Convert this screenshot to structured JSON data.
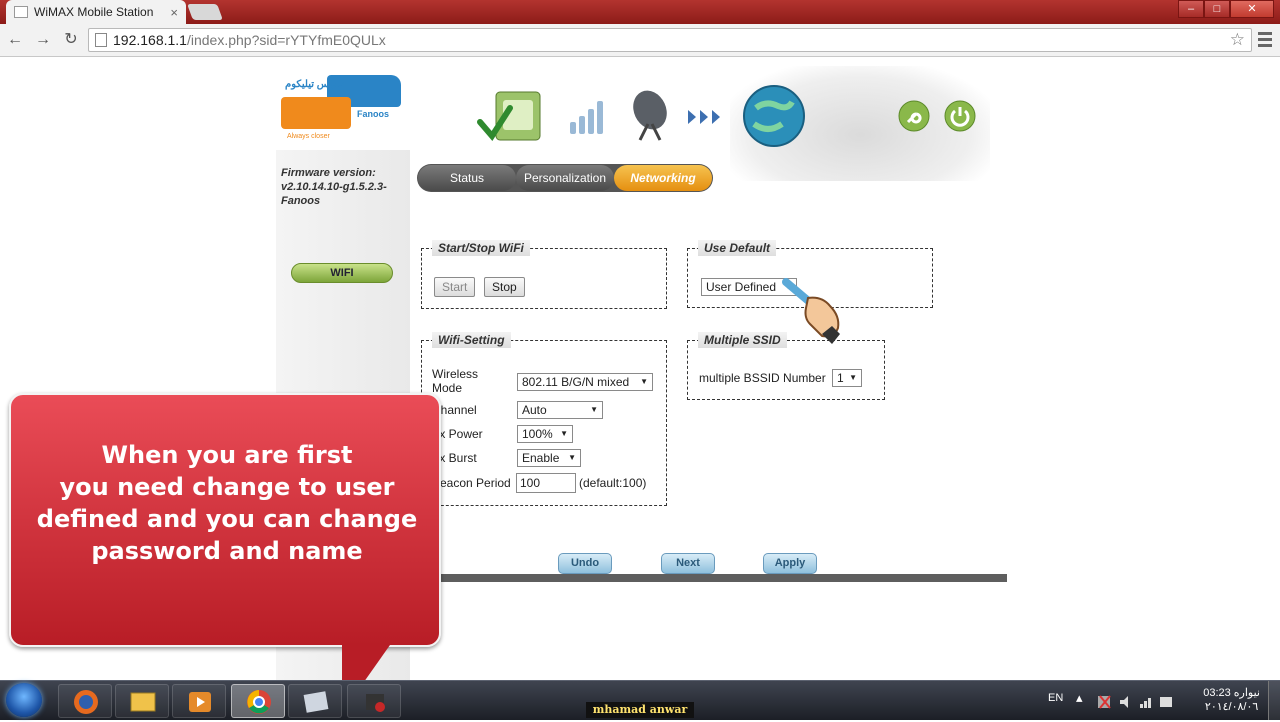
{
  "browser": {
    "tab_title": "WiMAX Mobile Station",
    "tab_close": "×",
    "url_host": "192.168.1.1",
    "url_path": "/index.php?sid=rYTYfmE0QULx",
    "star": "☆",
    "back": "←",
    "forward": "→",
    "reload": "↻",
    "window_minimize": "–",
    "window_maximize": "□",
    "window_close": "✕"
  },
  "logo": {
    "arabic": "فانوس تيليكوم",
    "brand": "Fanoos",
    "slogan": "Always closer"
  },
  "sidebar": {
    "firmware": "Firmware version: v2.10.14.10-g1.5.2.3-Fanoos",
    "wifi_button": "WIFI"
  },
  "tabs": [
    {
      "label": "Status"
    },
    {
      "label": "Personalization"
    },
    {
      "label": "Networking"
    }
  ],
  "start_stop": {
    "legend": "Start/Stop WiFi",
    "start_label": "Start",
    "stop_label": "Stop"
  },
  "use_default": {
    "legend": "Use Default",
    "selected": "User Defined"
  },
  "wifi_setting": {
    "legend": "Wifi-Setting",
    "wireless_mode_label": "Wireless\nMode",
    "wireless_mode_value": "802.11 B/G/N mixed",
    "channel_label": "Channel",
    "channel_value": "Auto",
    "tx_power_label": "Tx Power",
    "tx_power_value": "100%",
    "tx_burst_label": "Tx Burst",
    "tx_burst_value": "Enable",
    "beacon_label": "Beacon Period",
    "beacon_value": "100",
    "beacon_default": "(default:100)"
  },
  "multiple_ssid": {
    "legend": "Multiple SSID",
    "label": "multiple BSSID Number",
    "value": "1"
  },
  "actions": {
    "undo": "Undo",
    "next": "Next",
    "apply": "Apply"
  },
  "callout": {
    "text": "When you are first\nyou need change to user\ndefined and you can change\npassword and name"
  },
  "taskbar": {
    "watermark": "mhamad anwar",
    "language": "EN",
    "time": "03:23 نیواره",
    "date": "٢٠١٤/٠٨/٠٦"
  }
}
